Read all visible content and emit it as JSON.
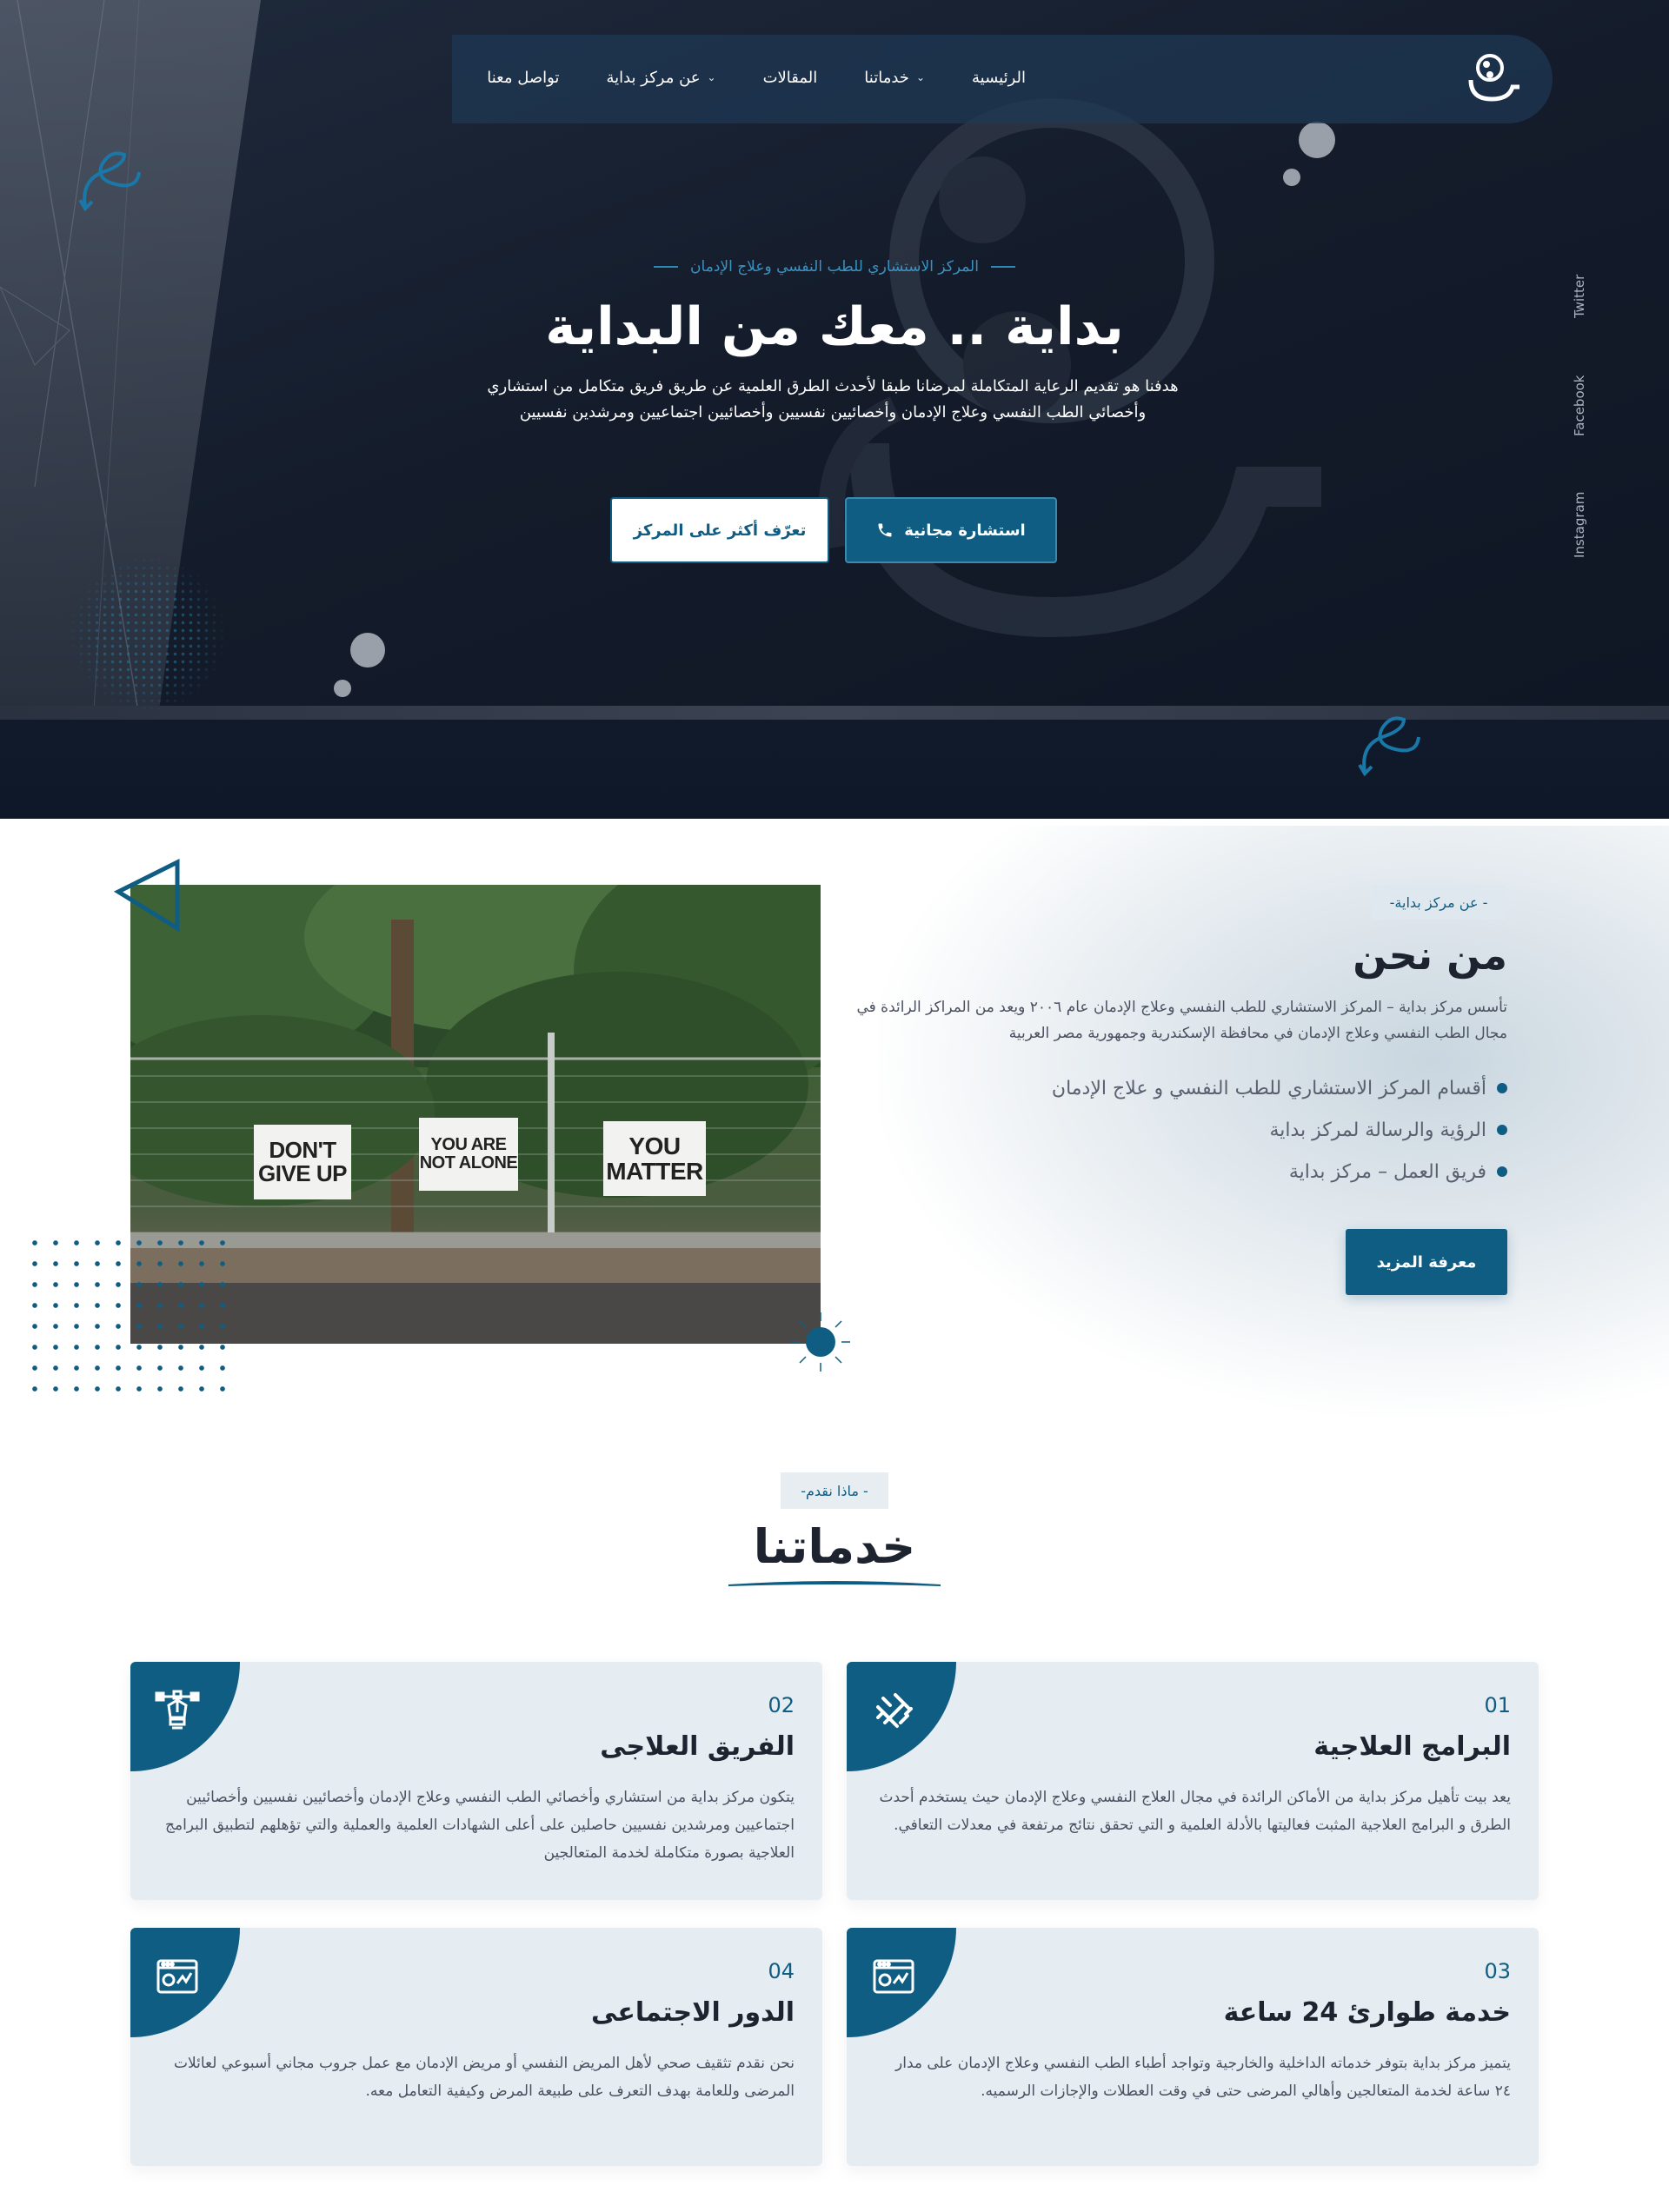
{
  "nav": {
    "items": [
      {
        "label": "الرئيسية",
        "has_dropdown": false
      },
      {
        "label": "خدماتنا",
        "has_dropdown": true
      },
      {
        "label": "المقالات",
        "has_dropdown": false
      },
      {
        "label": "عن مركز بداية",
        "has_dropdown": true
      },
      {
        "label": "تواصل معنا",
        "has_dropdown": false
      }
    ]
  },
  "hero": {
    "subtitle": "المركز الاستشاري للطب النفسي وعلاج الإدمان",
    "title": "بداية .. معك من البداية",
    "description": "هدفنا هو تقديم الرعاية المتكاملة لمرضانا طبقا لأحدث الطرق العلمية عن طريق فريق متكامل من استشاري وأخصائي الطب النفسي وعلاج الإدمان وأخصائيين نفسيين وأخصائيين اجتماعيين ومرشدين نفسيين",
    "primary_button": "استشارة مجانية",
    "secondary_button": "تعرّف أكثر على المركز",
    "social": [
      "Twitter",
      "Facebook",
      "Instagram"
    ]
  },
  "about": {
    "badge": "-عن مركز بداية -",
    "title": "من نحن",
    "text": "تأسس مركز بداية – المركز الاستشاري للطب النفسي وعلاج الإدمان عام ٢٠٠٦ ويعد من المراكز الرائدة في مجال الطب النفسي وعلاج الإدمان في محافظة الإسكندرية وجمهورية مصر العربية",
    "list": [
      "أقسام المركز الاستشاري للطب النفسي و علاج الإدمان",
      "الرؤية والرسالة لمركز بداية",
      "فريق العمل – مركز بداية"
    ],
    "button": "معرفة المزيد",
    "photo_signs": [
      "DON'T GIVE UP",
      "YOU ARE NOT ALONE",
      "YOU MATTER"
    ]
  },
  "services": {
    "badge": "-ماذا نقدم -",
    "title": "خدماتنا",
    "cards": [
      {
        "num": "01",
        "title": "البرامج العلاجية",
        "icon": "pattern-icon",
        "desc": "يعد بيت تأهيل مركز بداية من الأماكن الرائدة في مجال العلاج النفسي وعلاج الإدمان حيث يستخدم أحدث الطرق و البرامج العلاجية المثبت فعاليتها بالأدلة العلمية و التي تحقق نتائج مرتفعة في معدلات التعافي."
      },
      {
        "num": "02",
        "title": "الفريق العلاجى",
        "icon": "pen-tool-icon",
        "desc": "يتكون مركز بداية من استشاري وأخصائي الطب النفسي وعلاج الإدمان وأخصائيين نفسيين وأخصائيين اجتماعيين ومرشدين نفسيين حاصلين على أعلى الشهادات العلمية والعملية والتي تؤهلهم لتطبيق البرامج العلاجية بصورة متكاملة لخدمة المتعالجين"
      },
      {
        "num": "03",
        "title": "خدمة طوارئ 24 ساعة",
        "icon": "browser-chart-icon",
        "desc": "يتميز مركز بداية بتوفر خدماته الداخلية والخارجية وتواجد أطباء الطب النفسي وعلاج الإدمان على مدار ٢٤ ساعة لخدمة المتعالجين وأهالي المرضى حتى في وقت العطلات والإجازات الرسميه."
      },
      {
        "num": "04",
        "title": "الدور الاجتماعى",
        "icon": "browser-chart-icon",
        "desc": "نحن نقدم تثقيف صحي لأهل المريض النفسي أو مريض الإدمان مع عمل جروب مجاني أسبوعي لعائلات المرضى وللعامة بهدف التعرف على طبيعة المرض وكيفية التعامل معه."
      }
    ]
  },
  "colors": {
    "brand": "#0f5d82",
    "hero_bg": "#141c2b",
    "card_bg": "#e6edf2",
    "accent_text": "#3a92c1"
  }
}
